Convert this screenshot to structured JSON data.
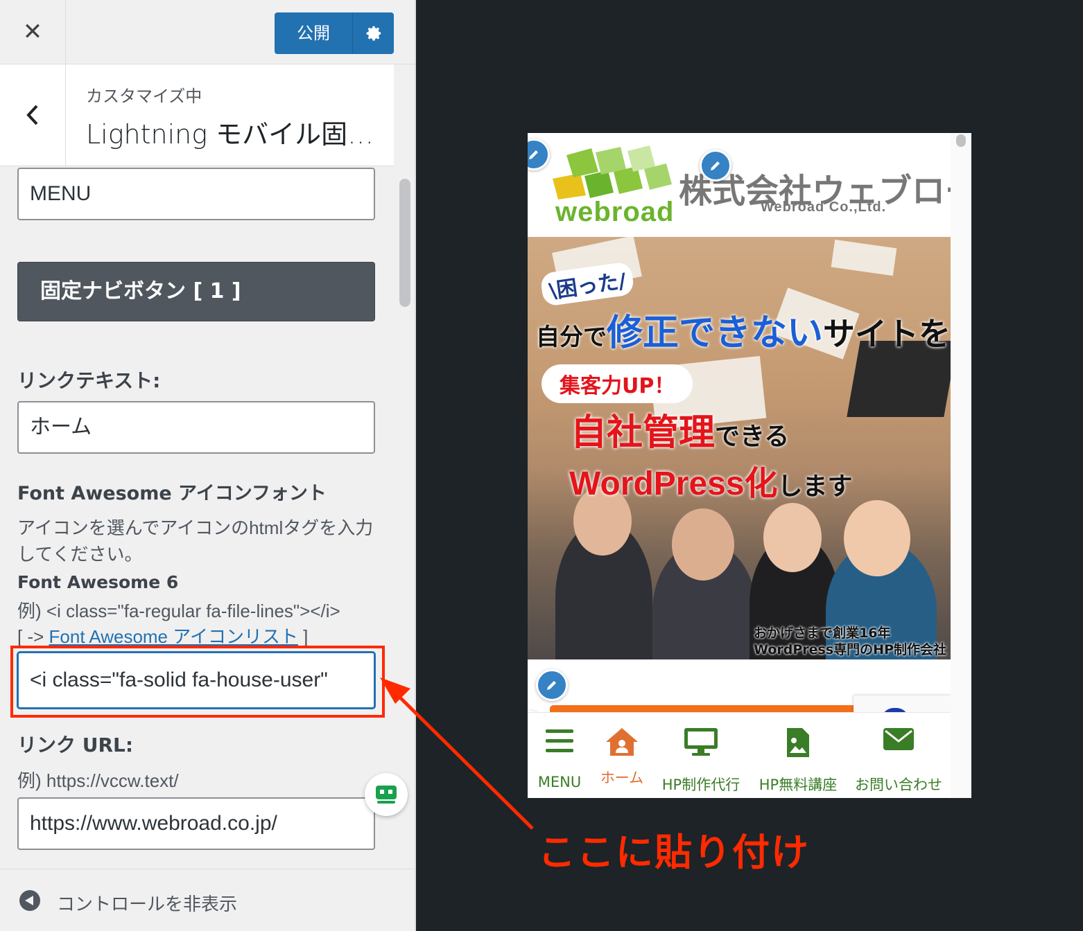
{
  "customizer": {
    "publish_label": "公開",
    "section_sub": "カスタマイズ中",
    "section_title": "Lightning モバイル固…",
    "menu_field_value": "MENU",
    "nav_button_label": "固定ナビボタン [ 1 ]",
    "link_text_label": "リンクテキスト:",
    "link_text_value": "ホーム",
    "fa_heading": "Font Awesome アイコンフォント",
    "fa_desc_line1": "アイコンを選んでアイコンのhtmlタグを入力",
    "fa_desc_line2": "してください。",
    "fa_version": "Font Awesome 6",
    "fa_example": "例) <i class=\"fa-regular fa-file-lines\"></i>",
    "fa_list_prefix": "[ -> ",
    "fa_list_link": "Font Awesome アイコンリスト",
    "fa_list_suffix": " ]",
    "fa_input_value": "<i class=\"fa-solid fa-house-user\"",
    "link_url_label": "リンク URL:",
    "link_url_example": "例) https://vccw.text/",
    "link_url_value": "https://www.webroad.co.jp/",
    "collapse_label": "コントロールを非表示"
  },
  "preview": {
    "logo_text": "webroad",
    "company_name_jp": "株式会社ウェブロー",
    "company_name_en": "Webroad Co.,Ltd.",
    "hero": {
      "tag": "\\困った/",
      "line1_a": "自分で",
      "line1_b": "修正できない",
      "line1_c": "サイトを",
      "bubble": "集客力UP！",
      "line2_a": "自社管理",
      "line2_b": "できる",
      "line3_a": "WordPress化",
      "line3_b": "します",
      "footer_line1": "おかげさまで創業16年",
      "footer_line2": "WordPress専門のHP制作会社"
    },
    "nav": [
      {
        "label": "MENU",
        "icon": "bars-icon"
      },
      {
        "label": "ホーム",
        "icon": "house-user-icon"
      },
      {
        "label": "HP制作代行",
        "icon": "desktop-icon"
      },
      {
        "label": "HP無料講座",
        "icon": "file-image-icon"
      },
      {
        "label": "お問い合わせ",
        "icon": "envelope-icon"
      }
    ]
  },
  "annotation": {
    "text": "ここに貼り付け",
    "color": "#ff2a00"
  },
  "colors": {
    "accent": "#2271b1",
    "nav_green": "#3a7d27",
    "nav_active": "#e07032",
    "highlight": "#ff2a00"
  }
}
